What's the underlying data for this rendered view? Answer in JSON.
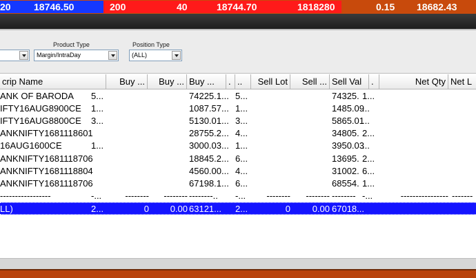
{
  "ticker": {
    "items": [
      "20",
      "18746.50",
      "200",
      "40",
      "18744.70",
      "1818280",
      "0.15",
      "18682.43"
    ]
  },
  "filters": {
    "first_value": "",
    "product_type_label": "Product Type",
    "product_type_value": "Margin/IntraDay",
    "position_type_label": "Position Type",
    "position_type_value": "(ALL)"
  },
  "grid": {
    "columns": [
      "crip Name",
      "Buy ...",
      "Buy ...",
      "Buy ...",
      ".",
      "..",
      "Sell Lot",
      "Sell ...",
      "Sell Val",
      ".",
      "Net Qty",
      "Net L"
    ],
    "rows": [
      {
        "name": "ANK OF BARODA",
        "a": "5...",
        "b": "",
        "c": "",
        "d": "74225.1...",
        "e": "5...",
        "f": "",
        "g": "",
        "h": "74325.",
        "i": "1...",
        "j": ""
      },
      {
        "name": "IFTY16AUG8900CE",
        "a": "1...",
        "b": "",
        "c": "",
        "d": "1087.57...",
        "e": "1...",
        "f": "",
        "g": "",
        "h": "1485.09",
        "i": "...",
        "j": ""
      },
      {
        "name": "IFTY16AUG8800CE",
        "a": "3...",
        "b": "",
        "c": "",
        "d": "5130.01...",
        "e": "3...",
        "f": "",
        "g": "",
        "h": "5865.01",
        "i": "...",
        "j": ""
      },
      {
        "name": "ANKNIFTY1681118601",
        "a": "",
        "b": "",
        "c": "",
        "d": "28755.2...",
        "e": "4...",
        "f": "",
        "g": "",
        "h": "34805.",
        "i": "2...",
        "j": ""
      },
      {
        "name": "16AUG1600CE",
        "a": "1...",
        "b": "",
        "c": "",
        "d": "3000.03...",
        "e": "1...",
        "f": "",
        "g": "",
        "h": "3950.03",
        "i": "...",
        "j": ""
      },
      {
        "name": "ANKNIFTY1681118706",
        "a": "",
        "b": "",
        "c": "",
        "d": "18845.2...",
        "e": "6...",
        "f": "",
        "g": "",
        "h": "13695.",
        "i": "2...",
        "j": ""
      },
      {
        "name": "ANKNIFTY1681118804",
        "a": "",
        "b": "",
        "c": "",
        "d": "4560.00...",
        "e": "4...",
        "f": "",
        "g": "",
        "h": "31002.",
        "i": "6...",
        "j": ""
      },
      {
        "name": "ANKNIFTY1681118706",
        "a": "",
        "b": "",
        "c": "",
        "d": "67198.1...",
        "e": "6...",
        "f": "",
        "g": "",
        "h": "68554.",
        "i": "1...",
        "j": ""
      }
    ],
    "separator_row": {
      "name": "-----------------",
      "a": "-...",
      "b": "--------",
      "c": "--------",
      "d": "--------..",
      "e": "-...",
      "f": "--------",
      "g": "--------",
      "h": "--------",
      "i": "-...",
      "j": "----------------",
      "k": "-------"
    },
    "total_row": {
      "name": "LL)",
      "a": "2...",
      "b": "0",
      "c": "0.00",
      "d": "63121...",
      "e": "2...",
      "f": "0",
      "g": "0.00",
      "h": "67018...",
      "i": "",
      "j": ""
    }
  },
  "colors": {
    "ticker_bg": "#c84a0c",
    "ticker_blue": "#1438ff",
    "ticker_red": "#ff1a1a",
    "selection_blue": "#1414ff"
  }
}
